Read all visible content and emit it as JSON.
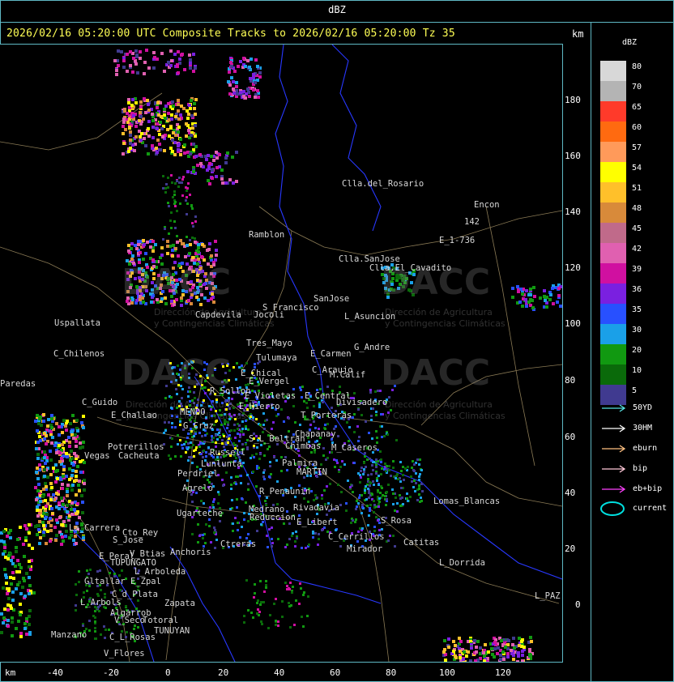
{
  "title": "dBZ",
  "header": "2026/02/16 05:20:00 UTC Composite Tracks to 2026/02/16 05:20:00 Tz 35",
  "units": {
    "top_right": "km",
    "bottom_left": "km"
  },
  "axes": {
    "y_ticks": [
      "180",
      "160",
      "140",
      "120",
      "100",
      "80",
      "60",
      "40",
      "20",
      "0"
    ],
    "x_ticks": [
      "-40",
      "-20",
      "0",
      "20",
      "40",
      "60",
      "80",
      "100",
      "120"
    ]
  },
  "legend": {
    "title": "dBZ",
    "scale": [
      {
        "label": "80",
        "color": "#d8d8d8"
      },
      {
        "label": "70",
        "color": "#b4b4b4"
      },
      {
        "label": "65",
        "color": "#ff3a2a"
      },
      {
        "label": "60",
        "color": "#ff6a10"
      },
      {
        "label": "57",
        "color": "#ff9a5a"
      },
      {
        "label": "54",
        "color": "#ffff00"
      },
      {
        "label": "51",
        "color": "#ffc02a"
      },
      {
        "label": "48",
        "color": "#d88a3a"
      },
      {
        "label": "45",
        "color": "#c06a8a"
      },
      {
        "label": "42",
        "color": "#e060b0"
      },
      {
        "label": "39",
        "color": "#d010a0"
      },
      {
        "label": "36",
        "color": "#7a20e0"
      },
      {
        "label": "35",
        "color": "#2850ff"
      },
      {
        "label": "30",
        "color": "#1aa0e8"
      },
      {
        "label": "20",
        "color": "#119911"
      },
      {
        "label": "10",
        "color": "#0a6a0a"
      },
      {
        "label": "5",
        "color": "#403a90"
      }
    ],
    "tracks": [
      {
        "label": "50YD",
        "color": "#55e0e0"
      },
      {
        "label": "30HM",
        "color": "#ffffff"
      },
      {
        "label": "eburn",
        "color": "#ffc080"
      },
      {
        "label": "bip",
        "color": "#ffc8d8"
      },
      {
        "label": "eb+bip",
        "color": "#ff40ff"
      }
    ],
    "current": {
      "label": "current",
      "color": "#00e0e0"
    }
  },
  "watermark": {
    "name": "DACC",
    "line1": "Dirección de Agricultura",
    "line2": "y Contingencias Climáticas"
  },
  "places": [
    {
      "name": "Clla.del_Rosario"
    },
    {
      "name": "Encon"
    },
    {
      "name": "142"
    },
    {
      "name": "E_1-736"
    },
    {
      "name": "Ramblon"
    },
    {
      "name": "Clla.SanJose"
    },
    {
      "name": "Clla.El_Cavadito"
    },
    {
      "name": "S_Francisco"
    },
    {
      "name": "SanJose"
    },
    {
      "name": "L_Asuncion"
    },
    {
      "name": "Capdevila"
    },
    {
      "name": "Jocoli"
    },
    {
      "name": "Uspallata"
    },
    {
      "name": "Tres_Mayo"
    },
    {
      "name": "C_Chilenos"
    },
    {
      "name": "Tulumaya"
    },
    {
      "name": "E_Carmen"
    },
    {
      "name": "G_Andre"
    },
    {
      "name": "C_Araujo"
    },
    {
      "name": "M.Calif"
    },
    {
      "name": "Paredas"
    },
    {
      "name": "E_Chical"
    },
    {
      "name": "E_Vergel"
    },
    {
      "name": "R_Sollon"
    },
    {
      "name": "E_Violetas"
    },
    {
      "name": "E_Central"
    },
    {
      "name": "Divisadero"
    },
    {
      "name": "C_Guido"
    },
    {
      "name": "E_Challao"
    },
    {
      "name": "E_Hierro"
    },
    {
      "name": "MENDO"
    },
    {
      "name": "T_Porteras"
    },
    {
      "name": "G_Cruz"
    },
    {
      "name": "Chapanay"
    },
    {
      "name": "S_L_Beltran"
    },
    {
      "name": "Chimbas"
    },
    {
      "name": "M_Caseros"
    },
    {
      "name": "Potrerillos"
    },
    {
      "name": "Vegas"
    },
    {
      "name": "Cacheuta"
    },
    {
      "name": "Russell"
    },
    {
      "name": "Palmira"
    },
    {
      "name": "Lunlunta"
    },
    {
      "name": "MARTIN"
    },
    {
      "name": "Perdriel"
    },
    {
      "name": "Ugarteche"
    },
    {
      "name": "Agrelo"
    },
    {
      "name": "R_Penaunin"
    },
    {
      "name": "Rivadavia"
    },
    {
      "name": "Medrano"
    },
    {
      "name": "Reduccion"
    },
    {
      "name": "E_Libert"
    },
    {
      "name": "Catitas"
    },
    {
      "name": "Lomas_Blancas"
    },
    {
      "name": "La_Carrera"
    },
    {
      "name": "Cto_Rey"
    },
    {
      "name": "S_Jose"
    },
    {
      "name": "Anchoris"
    },
    {
      "name": "Ctreras"
    },
    {
      "name": "E_Peral"
    },
    {
      "name": "V_Btias"
    },
    {
      "name": "TUPUNGATO"
    },
    {
      "name": "L_Arboleda"
    },
    {
      "name": "Gltallar"
    },
    {
      "name": "E_Zpal"
    },
    {
      "name": "L_Arbols"
    },
    {
      "name": "C_d_Plata"
    },
    {
      "name": "Zapata"
    },
    {
      "name": "L_Dorrida"
    },
    {
      "name": "Mirador"
    },
    {
      "name": "Algarrob"
    },
    {
      "name": "V_Seco"
    },
    {
      "name": "Totoral"
    },
    {
      "name": "TUNUYAN"
    },
    {
      "name": "Manzano"
    },
    {
      "name": "C_L_Rosas"
    },
    {
      "name": "V_Flores"
    },
    {
      "name": "L_PAZ"
    },
    {
      "name": "S_Rosa"
    },
    {
      "name": "C_Cerrillos"
    }
  ]
}
